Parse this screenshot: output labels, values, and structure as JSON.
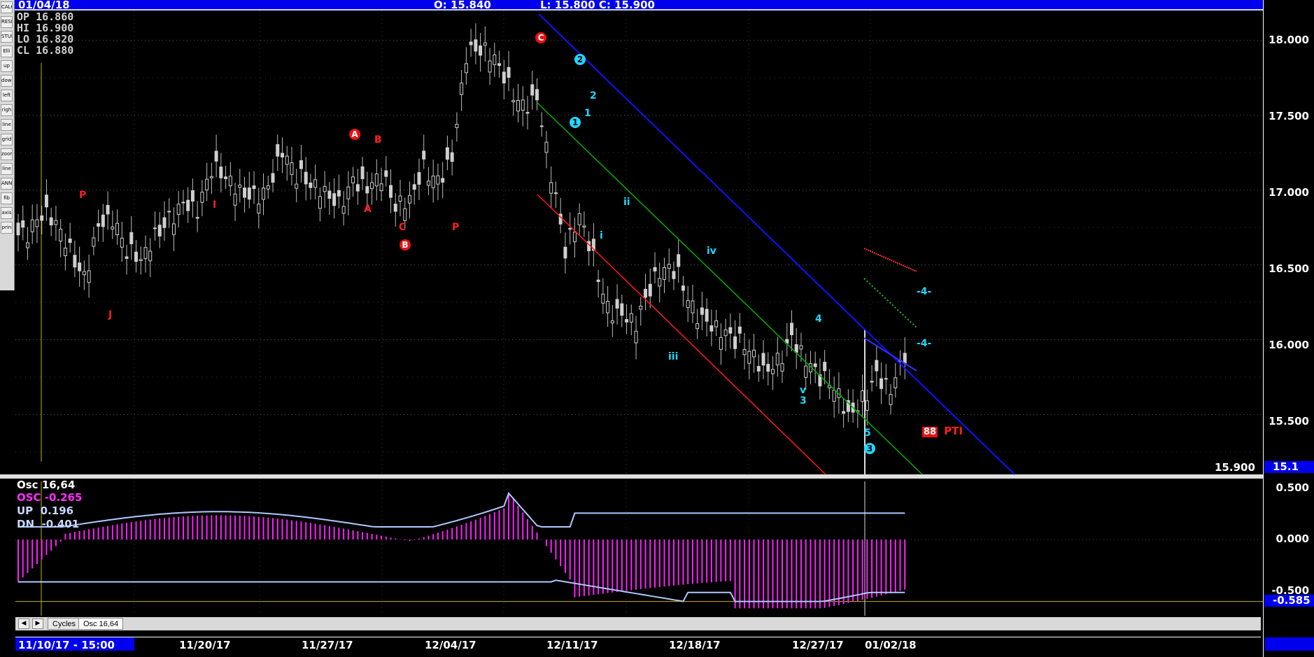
{
  "header": {
    "date": "01/04/18",
    "open_quote": "O: 15.840",
    "low_close_quote": "L: 15.800   C: 15.900"
  },
  "toolbar": {
    "items": [
      "CALC",
      "RESET",
      "STUDY",
      "Elliott",
      "up",
      "down",
      "left",
      "right",
      "line",
      "grid",
      "zoom",
      "lines",
      "ANN",
      "fib",
      "axis",
      "print"
    ]
  },
  "ohlc": {
    "open": {
      "label": "OP",
      "value": "16.860"
    },
    "high": {
      "label": "HI",
      "value": "16.900"
    },
    "low": {
      "label": "LO",
      "value": "16.820"
    },
    "close": {
      "label": "CL",
      "value": "16.880"
    }
  },
  "price_axis": {
    "ticks": [
      "18.000",
      "17.500",
      "17.000",
      "16.500",
      "16.000",
      "15.500"
    ],
    "last_price": "15.900",
    "last_badge": "15.1",
    "ylim": [
      15.1,
      18.2
    ]
  },
  "wave_labels": [
    {
      "text": "P",
      "color": "red"
    },
    {
      "text": "J",
      "color": "red"
    },
    {
      "text": "I",
      "color": "red"
    },
    {
      "text": "A",
      "color": "red",
      "circled": true
    },
    {
      "text": "B",
      "color": "red"
    },
    {
      "text": "A",
      "color": "red"
    },
    {
      "text": "C",
      "color": "red"
    },
    {
      "text": "B",
      "color": "red",
      "circled": true
    },
    {
      "text": "P",
      "color": "red"
    },
    {
      "text": "C",
      "color": "red",
      "circled": true
    },
    {
      "text": "2",
      "color": "cyan",
      "circled": true
    },
    {
      "text": "1",
      "color": "cyan",
      "circled": true
    },
    {
      "text": "2",
      "color": "cyan"
    },
    {
      "text": "1",
      "color": "cyan"
    },
    {
      "text": "ii",
      "color": "cyan"
    },
    {
      "text": "i",
      "color": "cyan"
    },
    {
      "text": "iv",
      "color": "cyan"
    },
    {
      "text": "iii",
      "color": "cyan"
    },
    {
      "text": "4",
      "color": "cyan"
    },
    {
      "text": "v",
      "color": "cyan"
    },
    {
      "text": "3",
      "color": "cyan"
    },
    {
      "text": "5",
      "color": "cyan"
    },
    {
      "text": "3",
      "color": "cyan",
      "circled": true
    },
    {
      "text": "-4-",
      "color": "cyan"
    },
    {
      "text": "-4-",
      "color": "cyan"
    }
  ],
  "pti": {
    "value": "88",
    "label": "PTI"
  },
  "oscillator": {
    "title_label": "Osc",
    "title_value": "16,64",
    "osc": {
      "label": "OSC",
      "value": "-0.265"
    },
    "up": {
      "label": "UP",
      "value": "0.196"
    },
    "dn": {
      "label": "DN",
      "value": "-0.401"
    },
    "ticks": [
      "0.500",
      "0.000",
      "-0.500"
    ],
    "badge": "-0.585",
    "ylim": [
      -0.72,
      0.55
    ]
  },
  "tabs": [
    "Cycles",
    "Osc 16,64"
  ],
  "dates": [
    "11/10/17 - 15:00",
    "11/20/17",
    "11/27/17",
    "12/04/17",
    "12/11/17",
    "12/18/17",
    "12/27/17",
    "01/02/18"
  ],
  "colors": {
    "up_band": "#0000ee",
    "price_bars": "#d0d0d0",
    "red_channel": "#ff1a1a",
    "green_channel": "#00b000",
    "blue_channel": "#1010ff",
    "osc_hist": "#ff20ff",
    "band_line": "#b0c8ff",
    "cyan_label": "#20d8ff",
    "red_label": "#ff2020"
  },
  "chart_data": {
    "type": "candlestick",
    "title": "",
    "xlabel": "",
    "ylabel": "",
    "ylim": [
      15.1,
      18.2
    ],
    "x": [
      "11/10/17",
      "11/20/17",
      "11/27/17",
      "12/04/17",
      "12/11/17",
      "12/18/17",
      "12/27/17",
      "01/02/18"
    ],
    "close_path": [
      16.7,
      16.85,
      16.8,
      16.6,
      16.4,
      16.75,
      16.8,
      16.6,
      16.55,
      16.7,
      16.8,
      16.9,
      16.85,
      17.15,
      17.1,
      17.0,
      16.95,
      17.0,
      17.25,
      17.1,
      17.05,
      17.0,
      16.9,
      17.05,
      17.0,
      17.1,
      16.9,
      16.95,
      17.15,
      17.05,
      17.2,
      17.9,
      17.95,
      17.9,
      17.7,
      17.55,
      17.6,
      17.1,
      16.6,
      16.85,
      16.55,
      16.2,
      16.15,
      16.1,
      16.35,
      16.5,
      16.45,
      16.2,
      16.1,
      16.05,
      16.0,
      15.95,
      15.8,
      15.85,
      16.0,
      15.85,
      15.75,
      15.7,
      15.5,
      15.6,
      15.75,
      15.65,
      15.9
    ]
  }
}
